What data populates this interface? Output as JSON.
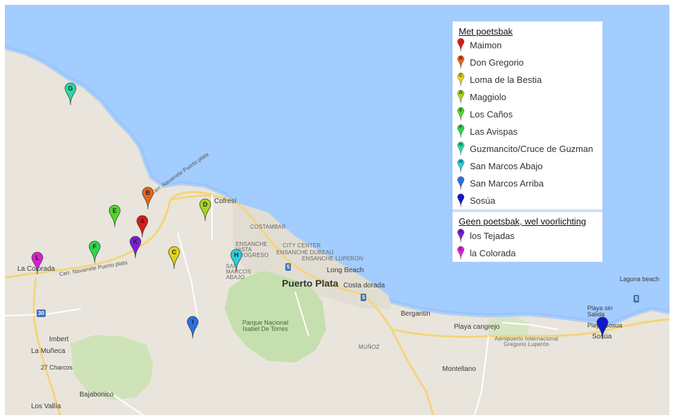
{
  "map": {
    "places": {
      "cofresi": "Cofresí",
      "costambar": "COSTAMBAR",
      "ensanche_vista": "ENSANCHE VISTA PROGRESO",
      "city_center": "CITY CENTER",
      "ensanche_dubeau": "ENSANCHE DUBEAU",
      "ensanche_luperon": "ENSANCHE LUPERON",
      "san_marcos": "SAN MARCOS ABAJO",
      "long_beach": "Long Beach",
      "puerto_plata": "Puerto Plata",
      "costa_dorada": "Costa dorada",
      "bergantin": "Bergantin",
      "playa_cangrejo": "Playa cangrejo",
      "airport": "Aeropuerto Internacional Gregorio Luperón",
      "montellano": "Montellano",
      "munoz": "MUÑOZ",
      "playa_sin_salida": "Playa sin Salida",
      "playa_sosua": "Playa Sosua",
      "sosua": "Sosúa",
      "laguna_beach": "Laguna beach",
      "la_colorada": "La Colorada",
      "imbert": "Imbert",
      "la_muneca": "La Muñeca",
      "charcos": "27 Charcos",
      "bajabonico": "Bajabonico",
      "los_vallia": "Los Vallía",
      "park": "Parque Nacional Isabel De Torres",
      "road_navarrete_1": "Carr. Navarrete Puerto plata",
      "road_navarrete_2": "Carr. Navarrete Puerto plata"
    },
    "shields": [
      "5",
      "5",
      "5",
      "30"
    ],
    "markers": [
      {
        "letter": "A",
        "color": "#d61b1b"
      },
      {
        "letter": "B",
        "color": "#e8641b"
      },
      {
        "letter": "C",
        "color": "#e2d21b"
      },
      {
        "letter": "D",
        "color": "#a6d81b"
      },
      {
        "letter": "E",
        "color": "#4fd82b"
      },
      {
        "letter": "F",
        "color": "#29d84a"
      },
      {
        "letter": "G",
        "color": "#2bd8a6"
      },
      {
        "letter": "H",
        "color": "#29cfe0"
      },
      {
        "letter": "I",
        "color": "#2b6fe0"
      },
      {
        "letter": "",
        "color": "#1018c8"
      },
      {
        "letter": "K",
        "color": "#7a1fd8"
      },
      {
        "letter": "L",
        "color": "#d81fd0"
      }
    ]
  },
  "legend": {
    "title_with": "Met poetsbak",
    "items_with": [
      {
        "label": "Maimon",
        "letter": "",
        "color": "#d61b1b"
      },
      {
        "label": "Don Gregorio",
        "letter": "B",
        "color": "#e8641b"
      },
      {
        "label": "Loma de la Bestia",
        "letter": "C",
        "color": "#e2d21b"
      },
      {
        "label": "Maggiolo",
        "letter": "D",
        "color": "#a6d81b"
      },
      {
        "label": "Los Caños",
        "letter": "E",
        "color": "#4fd82b"
      },
      {
        "label": "Las Avispas",
        "letter": "F",
        "color": "#29d84a"
      },
      {
        "label": "Guzmancito/Cruce de Guzman",
        "letter": "G",
        "color": "#2bd8a6"
      },
      {
        "label": "San Marcos Abajo",
        "letter": "H",
        "color": "#29cfe0"
      },
      {
        "label": "San Marcos Arriba",
        "letter": "",
        "color": "#2b6fe0"
      },
      {
        "label": "Sosúa",
        "letter": "",
        "color": "#1018c8"
      }
    ],
    "title_without": "Geen poetsbak, wel voorlichting",
    "items_without": [
      {
        "label": "los Tejadas",
        "letter": "K",
        "color": "#7a1fd8"
      },
      {
        "label": "la Colorada",
        "letter": "L",
        "color": "#d81fd0"
      }
    ]
  }
}
